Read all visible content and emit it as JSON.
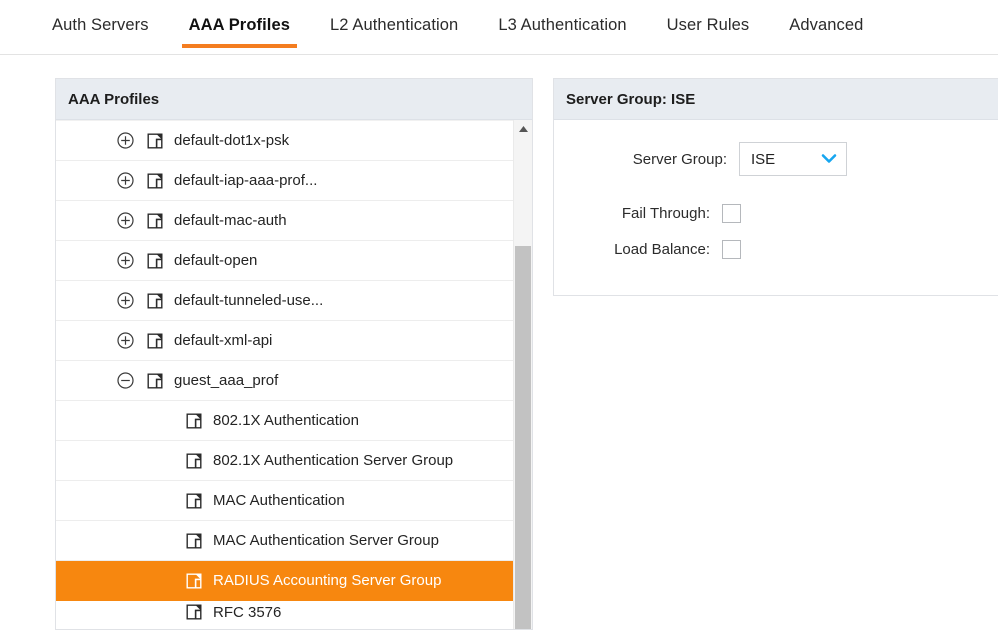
{
  "tabs": [
    {
      "label": "Auth Servers",
      "active": false
    },
    {
      "label": "AAA Profiles",
      "active": true
    },
    {
      "label": "L2 Authentication",
      "active": false
    },
    {
      "label": "L3 Authentication",
      "active": false
    },
    {
      "label": "User Rules",
      "active": false
    },
    {
      "label": "Advanced",
      "active": false
    }
  ],
  "left_panel": {
    "title": "AAA Profiles",
    "rows": [
      {
        "label": "default-dot1x-psk",
        "expander": "plus",
        "level": 1,
        "selected": false
      },
      {
        "label": "default-iap-aaa-prof...",
        "expander": "plus",
        "level": 1,
        "selected": false
      },
      {
        "label": "default-mac-auth",
        "expander": "plus",
        "level": 1,
        "selected": false
      },
      {
        "label": "default-open",
        "expander": "plus",
        "level": 1,
        "selected": false
      },
      {
        "label": "default-tunneled-use...",
        "expander": "plus",
        "level": 1,
        "selected": false
      },
      {
        "label": "default-xml-api",
        "expander": "plus",
        "level": 1,
        "selected": false
      },
      {
        "label": "guest_aaa_prof",
        "expander": "minus",
        "level": 1,
        "selected": false
      },
      {
        "label": "802.1X Authentication",
        "expander": "none",
        "level": 2,
        "selected": false
      },
      {
        "label": "802.1X Authentication Server Group",
        "expander": "none",
        "level": 2,
        "selected": false
      },
      {
        "label": "MAC Authentication",
        "expander": "none",
        "level": 2,
        "selected": false
      },
      {
        "label": "MAC Authentication Server Group",
        "expander": "none",
        "level": 2,
        "selected": false
      },
      {
        "label": "RADIUS Accounting Server Group",
        "expander": "none",
        "level": 2,
        "selected": true
      },
      {
        "label": "RFC 3576",
        "expander": "none",
        "level": 2,
        "selected": false,
        "partial": true
      }
    ],
    "scroll_up_icon": "triangle-up-icon"
  },
  "right_panel": {
    "title": "Server Group: ISE",
    "server_group_label": "Server Group:",
    "server_group_value": "ISE",
    "fail_through_label": "Fail Through:",
    "fail_through_checked": false,
    "load_balance_label": "Load Balance:",
    "load_balance_checked": false
  },
  "colors": {
    "accent_orange": "#f7870f",
    "tab_underline": "#f47d20",
    "panel_header_bg": "#e8ecf1",
    "dropdown_caret": "#17a6f0",
    "scrollbar_thumb": "#c2c2c2"
  }
}
